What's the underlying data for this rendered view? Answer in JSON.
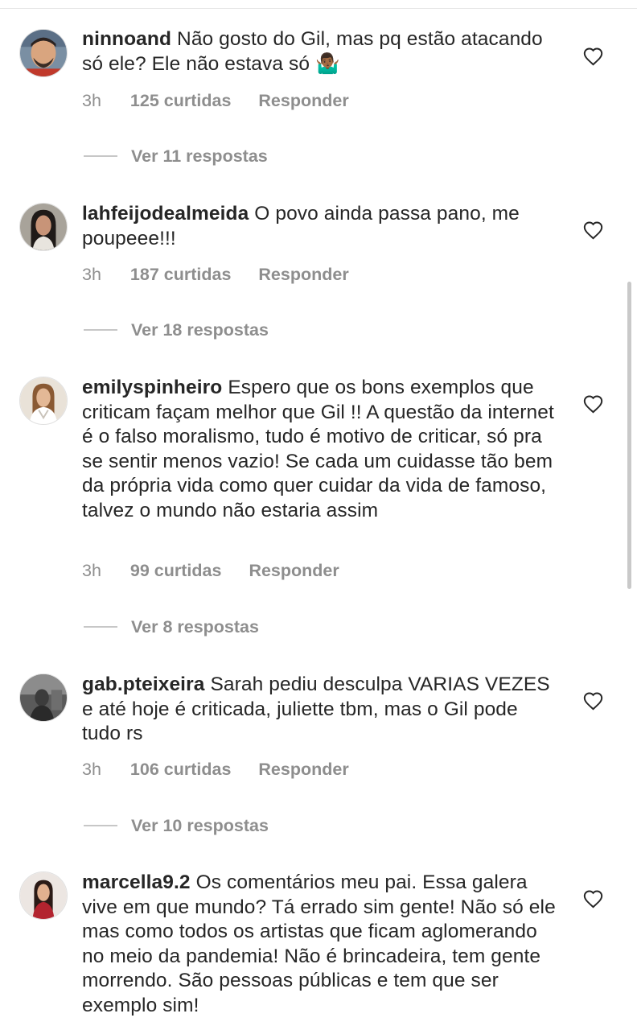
{
  "comments": [
    {
      "username": "ninnoand",
      "text": "Não gosto do Gil, mas pq estão atacando só ele? Ele não estava só 🤷🏾‍♂️",
      "time": "3h",
      "likes": "125 curtidas",
      "reply_label": "Responder",
      "view_replies": "Ver 11 respostas"
    },
    {
      "username": "lahfeijodealmeida",
      "text": "O povo ainda passa pano, me poupeee!!!",
      "time": "3h",
      "likes": "187 curtidas",
      "reply_label": "Responder",
      "view_replies": "Ver 18 respostas"
    },
    {
      "username": "emilyspinheiro",
      "text": "Espero que os bons exemplos que criticam façam melhor que Gil !! A questão da internet é o falso moralismo, tudo é motivo de criticar, só pra se sentir menos vazio! Se cada um cuidasse tão bem da própria vida como quer cuidar da vida de famoso, talvez o mundo não estaria assim",
      "time": "3h",
      "likes": "99 curtidas",
      "reply_label": "Responder",
      "view_replies": "Ver 8 respostas"
    },
    {
      "username": "gab.pteixeira",
      "text": "Sarah pediu desculpa VARIAS VEZES e até hoje é criticada, juliette tbm, mas o Gil pode tudo rs",
      "time": "3h",
      "likes": "106 curtidas",
      "reply_label": "Responder",
      "view_replies": "Ver 10 respostas"
    },
    {
      "username": "marcella9.2",
      "text": "Os comentários meu pai. Essa galera vive em que mundo? Tá errado sim gente! Não só ele mas como todos os artistas que ficam aglomerando no meio da pandemia! Não é brincadeira, tem gente morrendo. São pessoas públicas e tem que ser exemplo sim!"
    }
  ],
  "icons": {
    "like": "heart-outline-icon"
  },
  "colors": {
    "text": "#262626",
    "secondary": "#8e8e8e"
  }
}
